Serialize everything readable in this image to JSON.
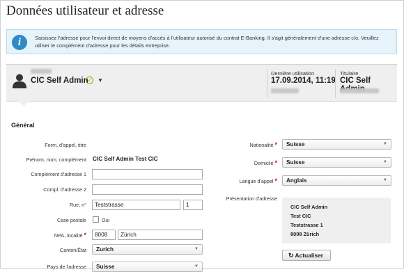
{
  "page": {
    "title": "Données utilisateur et adresse"
  },
  "info": {
    "icon": "info-icon",
    "text": "Saisissez l'adresse pour l'envoi direct de moyens d'accès à l'utilisateur autorisé du contrat E-Banking. Il s'agit généralement d'une adresse c/o. Veuillez utiliser le complément d'adresse pour les détails entreprise."
  },
  "header": {
    "user_name": "CIC Self Admin",
    "last_use_label": "Dernière utilisation",
    "last_use_value": "17.09.2014, 11:19",
    "holder_label": "Titulaire",
    "holder_value": "CIC Self Admin"
  },
  "section": {
    "title": "Général"
  },
  "form": {
    "salutation_label": "Form. d'appel, titre",
    "name_label": "Prénom, nom, complément",
    "name_value": "CIC Self Admin Test CIC",
    "addr_comp1_label": "Complément d'adresse 1",
    "addr_comp1_value": "",
    "addr_comp2_label": "Compl. d'adresse 2",
    "addr_comp2_value": "",
    "street_label": "Rue, n°",
    "street_value": "Teststrasse",
    "number_value": "1",
    "pobox_label": "Case postale",
    "pobox_option": "Oui",
    "zip_city_label": "NPA, localité",
    "zip_value": "8008",
    "city_value": "Zürich",
    "canton_label": "Canton/État",
    "canton_value": "Zurich",
    "country_label": "Pays de l'adresse",
    "country_value": "Suisse",
    "nationality_label": "Nationalité",
    "nationality_value": "Suisse",
    "domicile_label": "Domicile",
    "domicile_value": "Suisse",
    "language_label": "Langue d'appel",
    "language_value": "Anglais",
    "address_presentation_label": "Présentation d'adresse",
    "address_lines": [
      "CIC Self Admin",
      "Test CIC",
      "Teststrasse 1",
      "8008 Zürich"
    ],
    "refresh_label": "Actualiser",
    "required_marker": "*"
  },
  "colors": {
    "info_bg": "#e7f3fb",
    "info_icon": "#2f8ac7",
    "required": "#c8102e",
    "check": "#7bb31a"
  }
}
